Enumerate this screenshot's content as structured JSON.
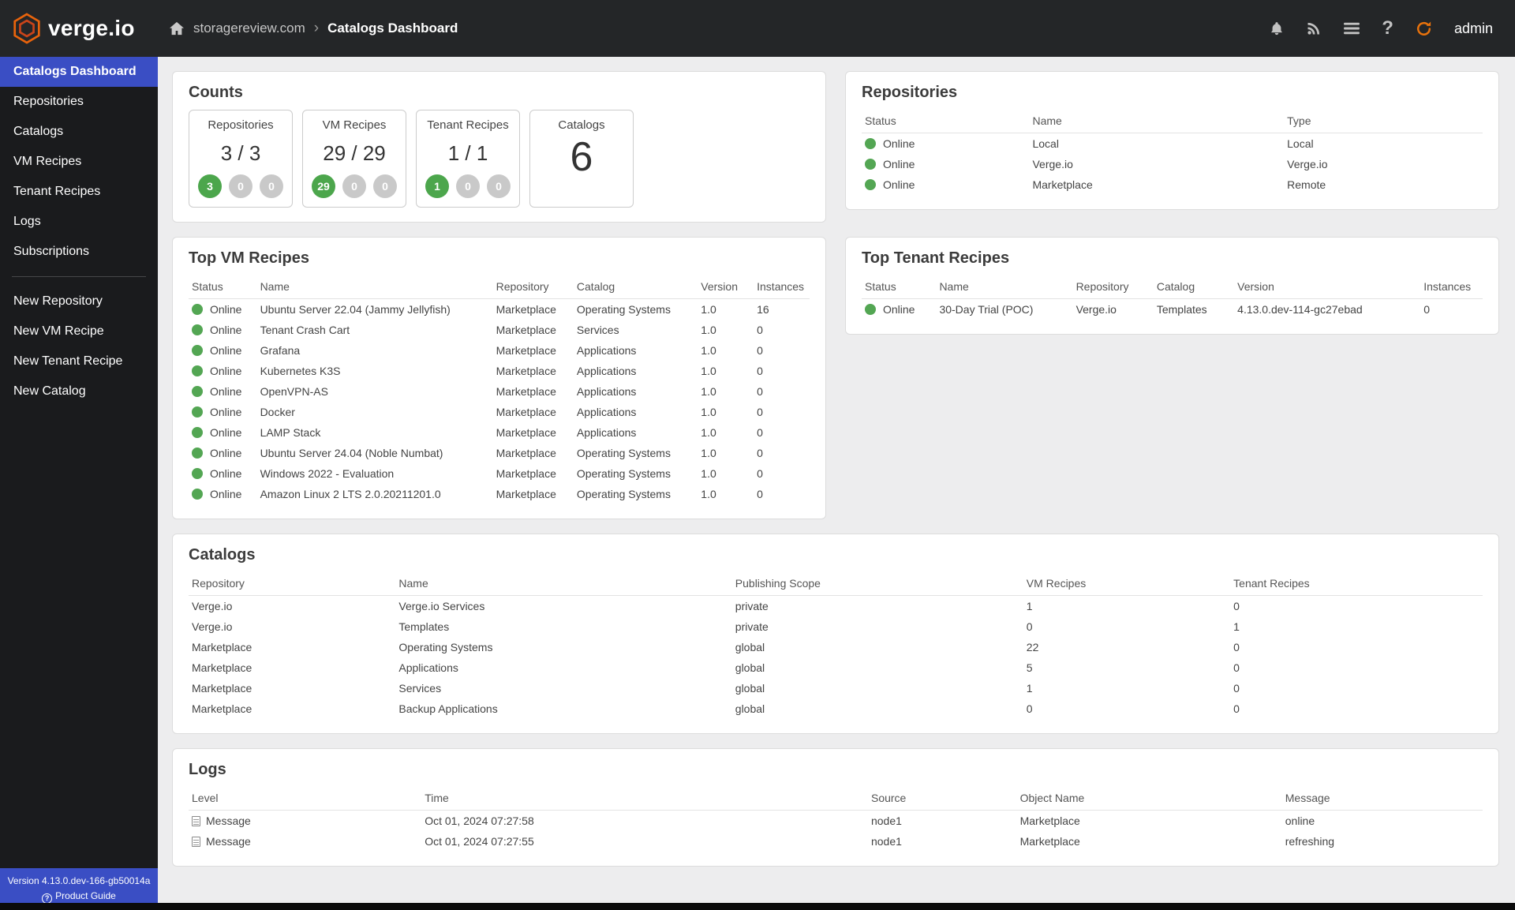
{
  "topbar": {
    "logo_text": "verge.io",
    "breadcrumb": {
      "site": "storagereview.com",
      "separator": "›",
      "page": "Catalogs Dashboard"
    },
    "user": "admin"
  },
  "sidebar": {
    "nav_items": [
      {
        "label": "Catalogs Dashboard",
        "active": true
      },
      {
        "label": "Repositories"
      },
      {
        "label": "Catalogs"
      },
      {
        "label": "VM Recipes"
      },
      {
        "label": "Tenant Recipes"
      },
      {
        "label": "Logs"
      },
      {
        "label": "Subscriptions"
      }
    ],
    "action_items": [
      {
        "label": "New Repository"
      },
      {
        "label": "New VM Recipe"
      },
      {
        "label": "New Tenant Recipe"
      },
      {
        "label": "New Catalog"
      }
    ],
    "footer": {
      "version": "Version 4.13.0.dev-166-gb50014a",
      "guide_label": "Product Guide"
    }
  },
  "colors": {
    "accent_blue": "#3a4ec4",
    "status_green": "#53a653",
    "badge_green": "#4ca64c",
    "badge_gray": "#c9c9c9",
    "refresh_orange": "#e8720c"
  },
  "counts": {
    "title": "Counts",
    "tiles": [
      {
        "label": "Repositories",
        "value": "3 / 3",
        "big": false,
        "badges": [
          {
            "value": "3",
            "type": "green"
          },
          {
            "value": "0",
            "type": "gray"
          },
          {
            "value": "0",
            "type": "gray"
          }
        ]
      },
      {
        "label": "VM Recipes",
        "value": "29 / 29",
        "big": false,
        "badges": [
          {
            "value": "29",
            "type": "green"
          },
          {
            "value": "0",
            "type": "gray"
          },
          {
            "value": "0",
            "type": "gray"
          }
        ]
      },
      {
        "label": "Tenant Recipes",
        "value": "1 / 1",
        "big": false,
        "badges": [
          {
            "value": "1",
            "type": "green"
          },
          {
            "value": "0",
            "type": "gray"
          },
          {
            "value": "0",
            "type": "gray"
          }
        ]
      },
      {
        "label": "Catalogs",
        "value": "6",
        "big": true,
        "badges": []
      }
    ]
  },
  "repositories": {
    "title": "Repositories",
    "columns": [
      "Status",
      "Name",
      "Type"
    ],
    "rows": [
      [
        {
          "text": "Online",
          "dot": true
        },
        "Local",
        "Local"
      ],
      [
        {
          "text": "Online",
          "dot": true
        },
        "Verge.io",
        "Verge.io"
      ],
      [
        {
          "text": "Online",
          "dot": true
        },
        "Marketplace",
        "Remote"
      ]
    ]
  },
  "top_vm_recipes": {
    "title": "Top VM Recipes",
    "columns": [
      "Status",
      "Name",
      "Repository",
      "Catalog",
      "Version",
      "Instances"
    ],
    "rows": [
      [
        {
          "text": "Online",
          "dot": true
        },
        "Ubuntu Server 22.04 (Jammy Jellyfish)",
        "Marketplace",
        "Operating Systems",
        "1.0",
        "16"
      ],
      [
        {
          "text": "Online",
          "dot": true
        },
        "Tenant Crash Cart",
        "Marketplace",
        "Services",
        "1.0",
        "0"
      ],
      [
        {
          "text": "Online",
          "dot": true
        },
        "Grafana",
        "Marketplace",
        "Applications",
        "1.0",
        "0"
      ],
      [
        {
          "text": "Online",
          "dot": true
        },
        "Kubernetes K3S",
        "Marketplace",
        "Applications",
        "1.0",
        "0"
      ],
      [
        {
          "text": "Online",
          "dot": true
        },
        "OpenVPN-AS",
        "Marketplace",
        "Applications",
        "1.0",
        "0"
      ],
      [
        {
          "text": "Online",
          "dot": true
        },
        "Docker",
        "Marketplace",
        "Applications",
        "1.0",
        "0"
      ],
      [
        {
          "text": "Online",
          "dot": true
        },
        "LAMP Stack",
        "Marketplace",
        "Applications",
        "1.0",
        "0"
      ],
      [
        {
          "text": "Online",
          "dot": true
        },
        "Ubuntu Server 24.04 (Noble Numbat)",
        "Marketplace",
        "Operating Systems",
        "1.0",
        "0"
      ],
      [
        {
          "text": "Online",
          "dot": true
        },
        "Windows 2022 - Evaluation",
        "Marketplace",
        "Operating Systems",
        "1.0",
        "0"
      ],
      [
        {
          "text": "Online",
          "dot": true
        },
        "Amazon Linux 2 LTS 2.0.20211201.0",
        "Marketplace",
        "Operating Systems",
        "1.0",
        "0"
      ]
    ]
  },
  "top_tenant_recipes": {
    "title": "Top Tenant Recipes",
    "columns": [
      "Status",
      "Name",
      "Repository",
      "Catalog",
      "Version",
      "Instances"
    ],
    "rows": [
      [
        {
          "text": "Online",
          "dot": true
        },
        "30-Day Trial (POC)",
        "Verge.io",
        "Templates",
        "4.13.0.dev-114-gc27ebad",
        "0"
      ]
    ]
  },
  "catalogs": {
    "title": "Catalogs",
    "columns": [
      "Repository",
      "Name",
      "Publishing Scope",
      "VM Recipes",
      "Tenant Recipes"
    ],
    "rows": [
      [
        "Verge.io",
        "Verge.io Services",
        "private",
        "1",
        "0"
      ],
      [
        "Verge.io",
        "Templates",
        "private",
        "0",
        "1"
      ],
      [
        "Marketplace",
        "Operating Systems",
        "global",
        "22",
        "0"
      ],
      [
        "Marketplace",
        "Applications",
        "global",
        "5",
        "0"
      ],
      [
        "Marketplace",
        "Services",
        "global",
        "1",
        "0"
      ],
      [
        "Marketplace",
        "Backup Applications",
        "global",
        "0",
        "0"
      ]
    ]
  },
  "logs": {
    "title": "Logs",
    "columns": [
      "Level",
      "Time",
      "Source",
      "Object Name",
      "Message"
    ],
    "rows": [
      [
        {
          "text": "Message",
          "icon": "doc"
        },
        "Oct 01, 2024 07:27:58",
        "node1",
        "Marketplace",
        "online"
      ],
      [
        {
          "text": "Message",
          "icon": "doc"
        },
        "Oct 01, 2024 07:27:55",
        "node1",
        "Marketplace",
        "refreshing"
      ]
    ]
  }
}
